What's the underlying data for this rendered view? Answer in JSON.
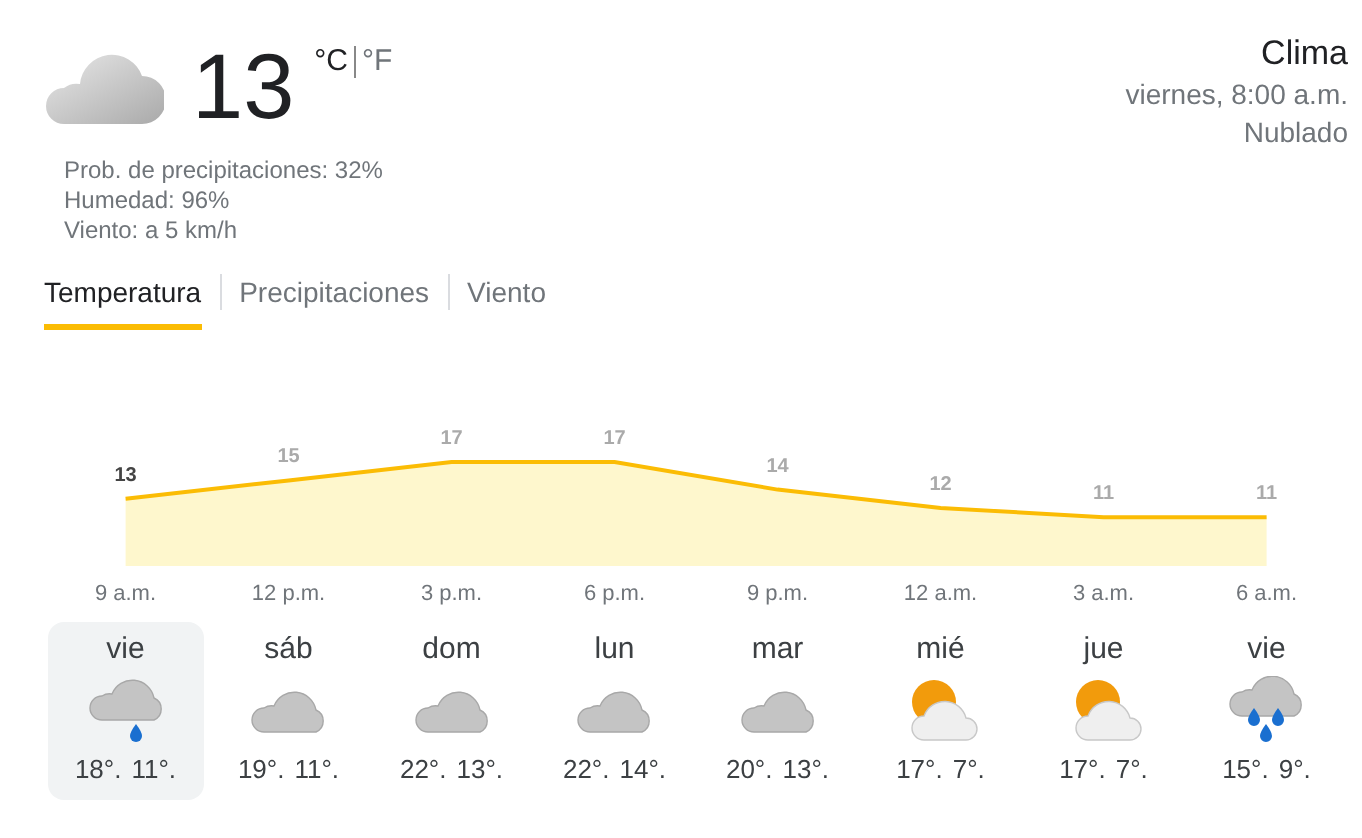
{
  "current": {
    "temperature": "13",
    "units": [
      {
        "label": "°C",
        "selected": true
      },
      {
        "label": "°F",
        "selected": false
      }
    ],
    "details": [
      "Prob. de precipitaciones: 32%",
      "Humedad: 96%",
      "Viento: a 5 km/h"
    ]
  },
  "summary": {
    "title": "Clima",
    "time": "viernes, 8:00 a.m.",
    "condition": "Nublado"
  },
  "tabs": [
    {
      "label": "Temperatura",
      "selected": true
    },
    {
      "label": "Precipitaciones",
      "selected": false
    },
    {
      "label": "Viento",
      "selected": false
    }
  ],
  "chart_data": {
    "type": "area",
    "categories": [
      "9 a.m.",
      "12 p.m.",
      "3 p.m.",
      "6 p.m.",
      "9 p.m.",
      "12 a.m.",
      "3 a.m.",
      "6 a.m."
    ],
    "series": [
      {
        "color": "#fbbc04",
        "values": [
          13,
          15,
          17,
          17,
          14,
          12,
          11,
          11
        ]
      }
    ],
    "data_labels": true
  },
  "days": [
    {
      "day": "vie",
      "kind": "rain",
      "high": "18°.",
      "low": "11°.",
      "selected": true
    },
    {
      "day": "sáb",
      "kind": "cloudy",
      "high": "19°.",
      "low": "11°.",
      "selected": false
    },
    {
      "day": "dom",
      "kind": "cloudy",
      "high": "22°.",
      "low": "13°.",
      "selected": false
    },
    {
      "day": "lun",
      "kind": "cloudy",
      "high": "22°.",
      "low": "14°.",
      "selected": false
    },
    {
      "day": "mar",
      "kind": "cloudy",
      "high": "20°.",
      "low": "13°.",
      "selected": false
    },
    {
      "day": "mié",
      "kind": "partly-sunny",
      "high": "17°.",
      "low": "7°.",
      "selected": false
    },
    {
      "day": "jue",
      "kind": "partly-sunny",
      "high": "17°.",
      "low": "7°.",
      "selected": false
    },
    {
      "day": "vie",
      "kind": "showers",
      "high": "15°.",
      "low": "9°.",
      "selected": false
    }
  ]
}
